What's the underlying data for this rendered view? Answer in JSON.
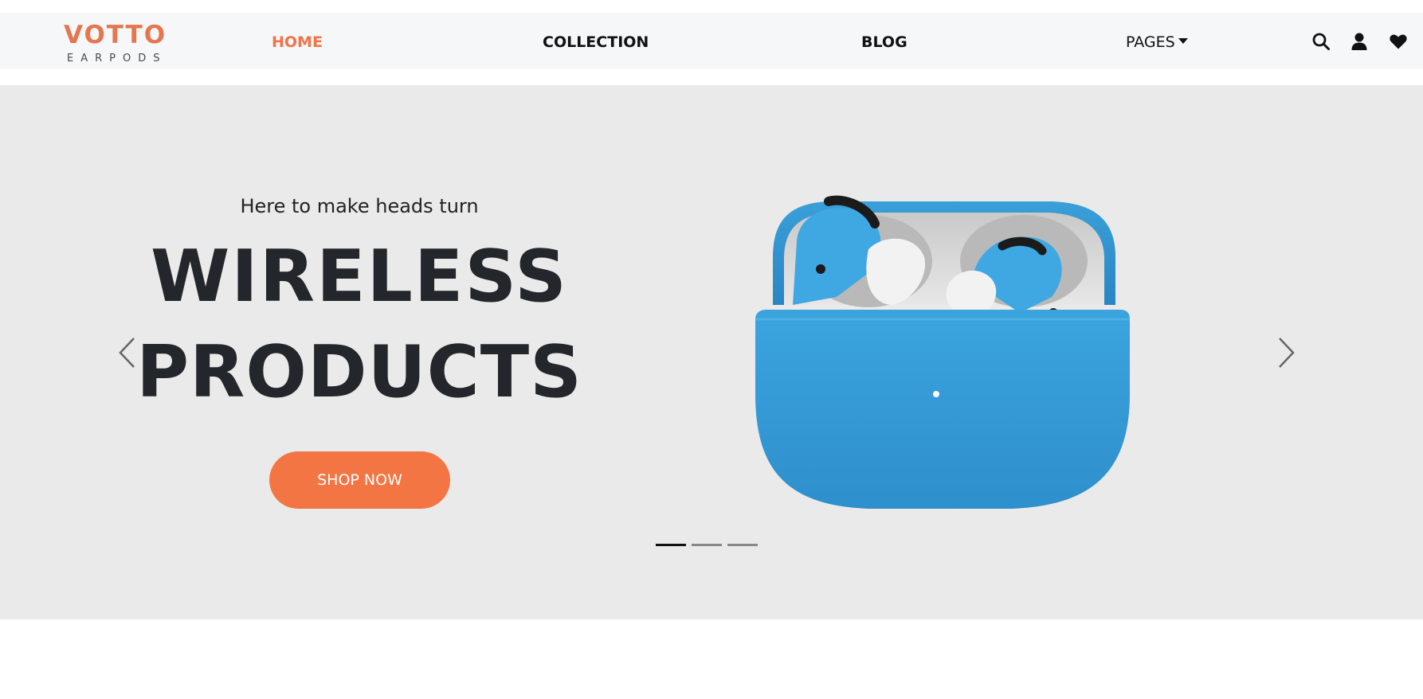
{
  "brand": {
    "name": "VOTTO",
    "sub": "EARPODS",
    "color": "#e4774f"
  },
  "nav": {
    "home": "HOME",
    "collection": "COLLECTION",
    "blog": "BLOG",
    "pages": "PAGES",
    "active_color": "#f0744a"
  },
  "icons": [
    "search-icon",
    "user-icon",
    "heart-icon",
    "chevron-left-icon",
    "chevron-right-icon"
  ],
  "hero": {
    "tagline": "Here to make heads turn",
    "headline_line1": "WIRELESS",
    "headline_line2": "PRODUCTS",
    "cta": "SHOP NOW",
    "cta_color": "#f47544",
    "background": "#eaeaea",
    "slide_count": 3,
    "active_slide": 1
  }
}
